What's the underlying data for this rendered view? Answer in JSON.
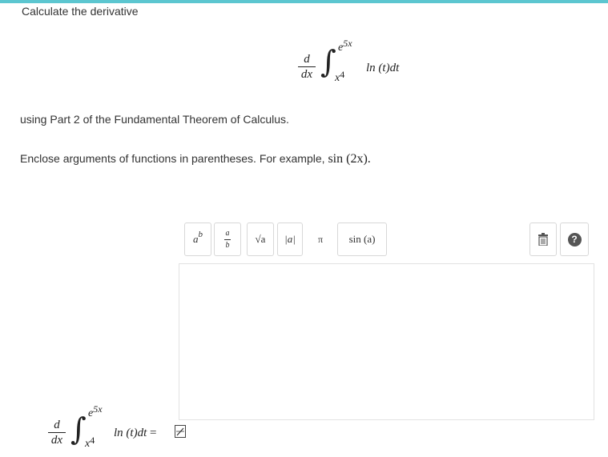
{
  "prompt": {
    "title": "Calculate the derivative",
    "using_text": "using Part 2 of the Fundamental Theorem of Calculus.",
    "enclose_text": "Enclose arguments of functions in parentheses. For example,",
    "example": "sin (2x)."
  },
  "integral": {
    "d_num": "d",
    "d_den": "dx",
    "sign": "∫",
    "upper": "e",
    "upper_exp": "5x",
    "lower": "x",
    "lower_exp": "4",
    "integrand": "ln (t)dt"
  },
  "toolbar": {
    "power_base": "a",
    "power_exp": "b",
    "frac_num": "a",
    "frac_den": "b",
    "sqrt_label": "√a",
    "abs_label": "|a|",
    "pi_label": "π",
    "sin_label": "sin (a)",
    "help_label": "?"
  },
  "answer": {
    "equals": "="
  },
  "colors": {
    "topbar": "#5cc6d0",
    "button_border": "#d8d8d8",
    "help_bg": "#555555"
  }
}
